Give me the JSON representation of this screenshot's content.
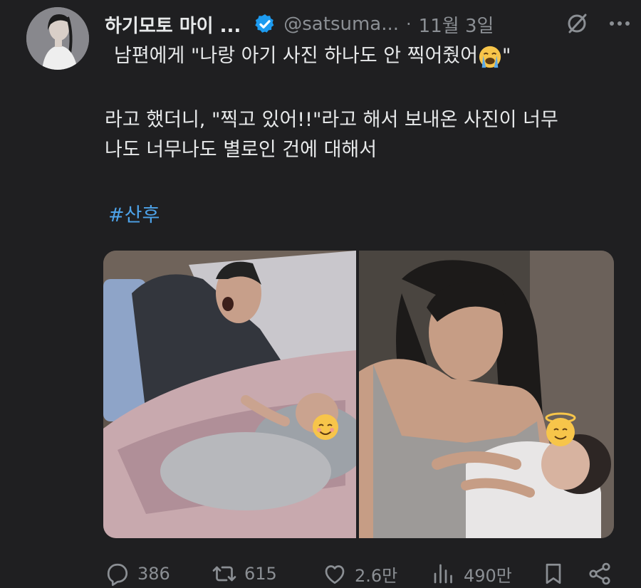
{
  "tweet": {
    "display_name": "하기모토 마이 ...",
    "handle": "@satsuma...",
    "separator": "·",
    "date": "11월 3일",
    "text_line1": "남편에게 \"나랑 아기 사진 하나도 안 찍어줬어",
    "text_line1_end": "\"",
    "text_line2": "라고 했더니, \"찍고 있어!!\"라고 해서 보내온 사진이 너무",
    "text_line3": "나도 너무나도 별로인 건에 대해서",
    "hashtag": "#산후"
  },
  "actions": {
    "replies": "386",
    "retweets": "615",
    "likes": "2.6만",
    "views": "490만"
  },
  "icons": {
    "verified": "verified-badge-icon",
    "grok": "slash-circle-icon",
    "more": "more-icon",
    "reply": "reply-icon",
    "retweet": "retweet-icon",
    "like": "heart-icon",
    "views": "views-icon",
    "bookmark": "bookmark-icon",
    "share": "share-icon"
  },
  "colors": {
    "background": "#1f1f21",
    "link": "#4da2e8",
    "verified": "#1d9bf0",
    "muted": "#8b8f94"
  }
}
